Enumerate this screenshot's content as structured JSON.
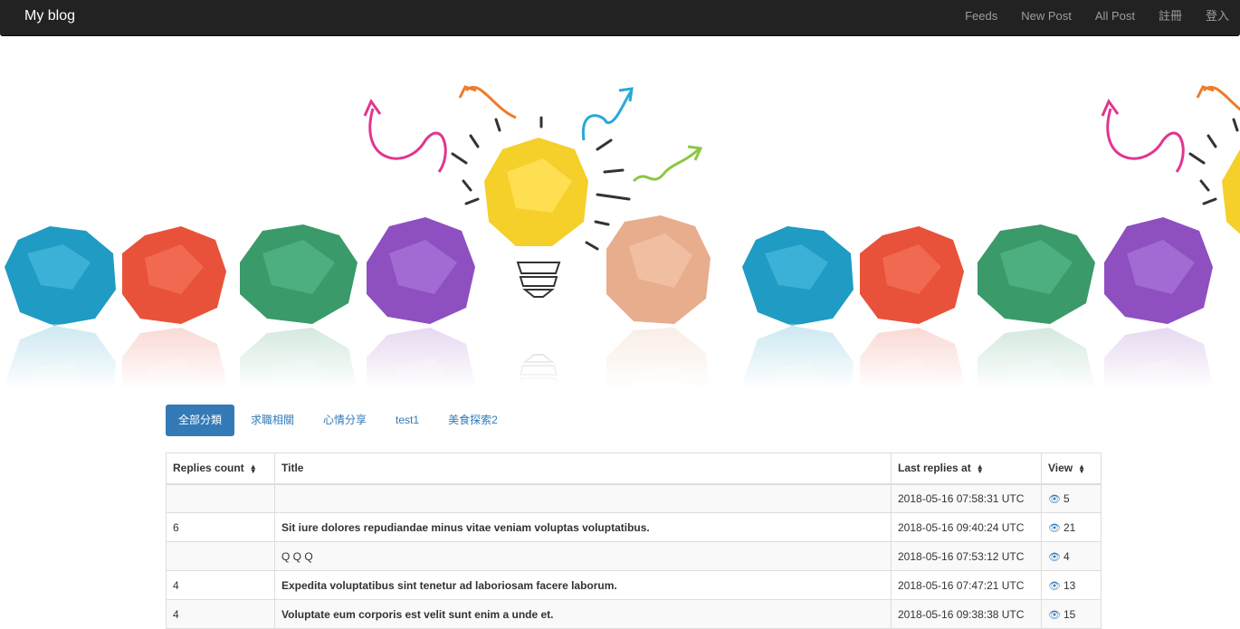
{
  "navbar": {
    "brand": "My blog",
    "links": [
      "Feeds",
      "New Post",
      "All Post",
      "註冊",
      "登入"
    ]
  },
  "hero": {
    "description": ""
  },
  "tabs": [
    {
      "label": "全部分類",
      "active": true
    },
    {
      "label": "求職相關",
      "active": false
    },
    {
      "label": "心情分享",
      "active": false
    },
    {
      "label": "test1",
      "active": false
    },
    {
      "label": "美食探索2",
      "active": false
    }
  ],
  "table": {
    "headers": {
      "replies": "Replies count",
      "title": "Title",
      "last_replies": "Last replies at",
      "view": "View"
    },
    "rows": [
      {
        "replies": "",
        "title": "",
        "last_replies": "2018-05-16 07:58:31 UTC",
        "views": "5"
      },
      {
        "replies": "6",
        "title": "Sit iure dolores repudiandae minus vitae veniam voluptas voluptatibus.",
        "last_replies": "2018-05-16 09:40:24 UTC",
        "views": "21"
      },
      {
        "replies": "",
        "title": "Q Q Q",
        "last_replies": "2018-05-16 07:53:12 UTC",
        "views": "4"
      },
      {
        "replies": "4",
        "title": "Expedita voluptatibus sint tenetur ad laboriosam facere laborum.",
        "last_replies": "2018-05-16 07:47:21 UTC",
        "views": "13"
      },
      {
        "replies": "4",
        "title": "Voluptate eum corporis est velit sunt enim a unde et.",
        "last_replies": "2018-05-16 09:38:38 UTC",
        "views": "15"
      }
    ]
  },
  "colors": {
    "navbar_bg": "#222222",
    "accent": "#337ab7",
    "paper_blue": "#1f9bc4",
    "paper_red": "#e8523a",
    "paper_green": "#3a9a6a",
    "paper_purple": "#8e4fc0",
    "paper_yellow": "#f5cf2a",
    "paper_peach": "#e7ad8c"
  }
}
